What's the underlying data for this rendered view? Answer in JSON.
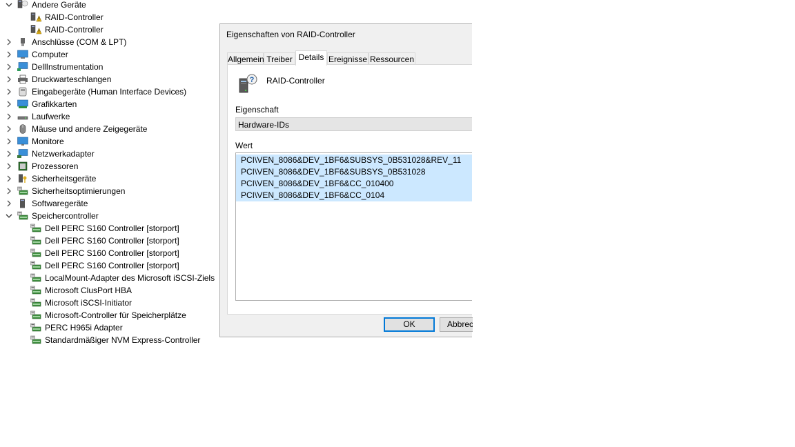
{
  "tree": {
    "andere_geraete": {
      "label": "Andere Geräte",
      "children": [
        "RAID-Controller",
        "RAID-Controller"
      ]
    },
    "categories": [
      {
        "label": "Anschlüsse (COM & LPT)",
        "icon": "port-icon"
      },
      {
        "label": "Computer",
        "icon": "computer-icon"
      },
      {
        "label": "DellInstrumentation",
        "icon": "monitor-network-icon"
      },
      {
        "label": "Druckwarteschlangen",
        "icon": "printer-icon"
      },
      {
        "label": "Eingabegeräte (Human Interface Devices)",
        "icon": "hid-icon"
      },
      {
        "label": "Grafikkarten",
        "icon": "display-adapter-icon"
      },
      {
        "label": "Laufwerke",
        "icon": "disk-drive-icon"
      },
      {
        "label": "Mäuse und andere Zeigegeräte",
        "icon": "mouse-icon"
      },
      {
        "label": "Monitore",
        "icon": "monitor-icon"
      },
      {
        "label": "Netzwerkadapter",
        "icon": "network-adapter-icon"
      },
      {
        "label": "Prozessoren",
        "icon": "processor-icon"
      },
      {
        "label": "Sicherheitsgeräte",
        "icon": "security-device-icon"
      },
      {
        "label": "Sicherheitsoptimierungen",
        "icon": "security-optimization-icon"
      },
      {
        "label": "Softwaregeräte",
        "icon": "software-device-icon"
      }
    ],
    "speichercontroller": {
      "label": "Speichercontroller",
      "children": [
        "Dell PERC S160 Controller [storport]",
        "Dell PERC S160 Controller [storport]",
        "Dell PERC S160 Controller [storport]",
        "Dell PERC S160 Controller [storport]",
        "LocalMount-Adapter des Microsoft iSCSI-Ziels",
        "Microsoft ClusPort HBA",
        "Microsoft iSCSI-Initiator",
        "Microsoft-Controller für Speicherplätze",
        "PERC H965i Adapter",
        "Standardmäßiger NVM Express-Controller"
      ]
    }
  },
  "dialog": {
    "title": "Eigenschaften von RAID-Controller",
    "tabs": [
      "Allgemein",
      "Treiber",
      "Details",
      "Ereignisse",
      "Ressourcen"
    ],
    "active_tab": "Details",
    "device_name": "RAID-Controller",
    "property_label": "Eigenschaft",
    "property_value": "Hardware-IDs",
    "value_label": "Wert",
    "values": [
      "PCI\\VEN_8086&DEV_1BF6&SUBSYS_0B531028&REV_11",
      "PCI\\VEN_8086&DEV_1BF6&SUBSYS_0B531028",
      "PCI\\VEN_8086&DEV_1BF6&CC_010400",
      "PCI\\VEN_8086&DEV_1BF6&CC_0104"
    ],
    "ok_label": "OK",
    "cancel_label": "Abbrechen"
  },
  "colors": {
    "selection": "#cce8ff",
    "default_button_border": "#0078d7"
  }
}
